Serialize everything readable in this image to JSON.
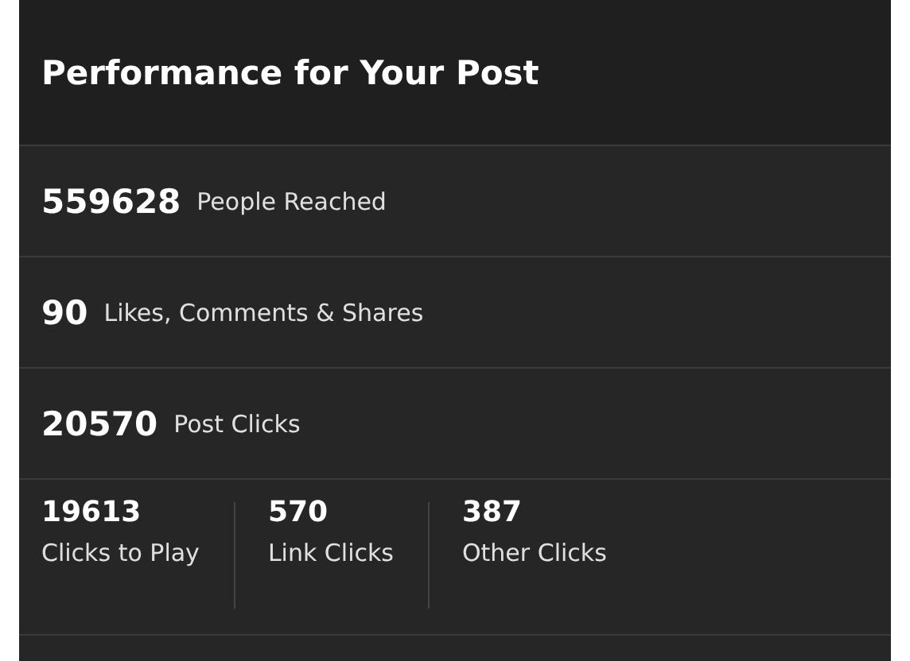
{
  "title": "Performance for Your Post",
  "metrics": [
    {
      "value": "559628",
      "label": "People Reached"
    },
    {
      "value": "90",
      "label": "Likes, Comments & Shares"
    },
    {
      "value": "20570",
      "label": "Post Clicks"
    }
  ],
  "breakdown": [
    {
      "value": "19613",
      "label": "Clicks to Play"
    },
    {
      "value": "570",
      "label": "Link Clicks"
    },
    {
      "value": "387",
      "label": "Other Clicks"
    }
  ]
}
